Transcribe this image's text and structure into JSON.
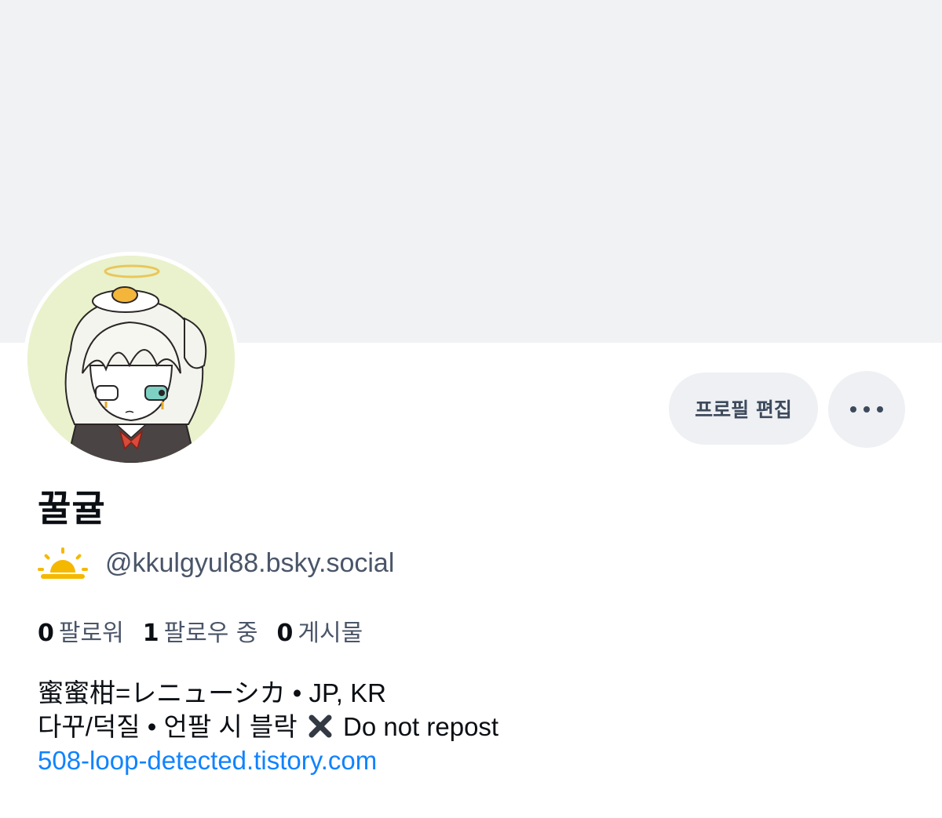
{
  "banner": {
    "color": "#f1f2f4"
  },
  "profile": {
    "display_name": "꿀귤",
    "handle": "@kkulgyul88.bsky.social",
    "handle_icon": "sun-rising-icon"
  },
  "actions": {
    "edit_profile_label": "프로필 편집",
    "more_icon": "more-horizontal-icon"
  },
  "stats": {
    "followers_count": "0",
    "followers_label": "팔로워",
    "following_count": "1",
    "following_label": "팔로우 중",
    "posts_count": "0",
    "posts_label": "게시물"
  },
  "bio": {
    "line1": "蜜蜜柑=レニューシカ • JP, KR",
    "line2_before": "다꾸/덕질 • 언팔 시 블락",
    "line2_icon": "cross-mark-icon",
    "line2_after": "Do not repost",
    "link": "508-loop-detected.tistory.com"
  },
  "colors": {
    "text_primary": "#0b0f14",
    "text_secondary": "#4a5568",
    "link": "#1083fe",
    "button_bg": "#eef0f3"
  }
}
